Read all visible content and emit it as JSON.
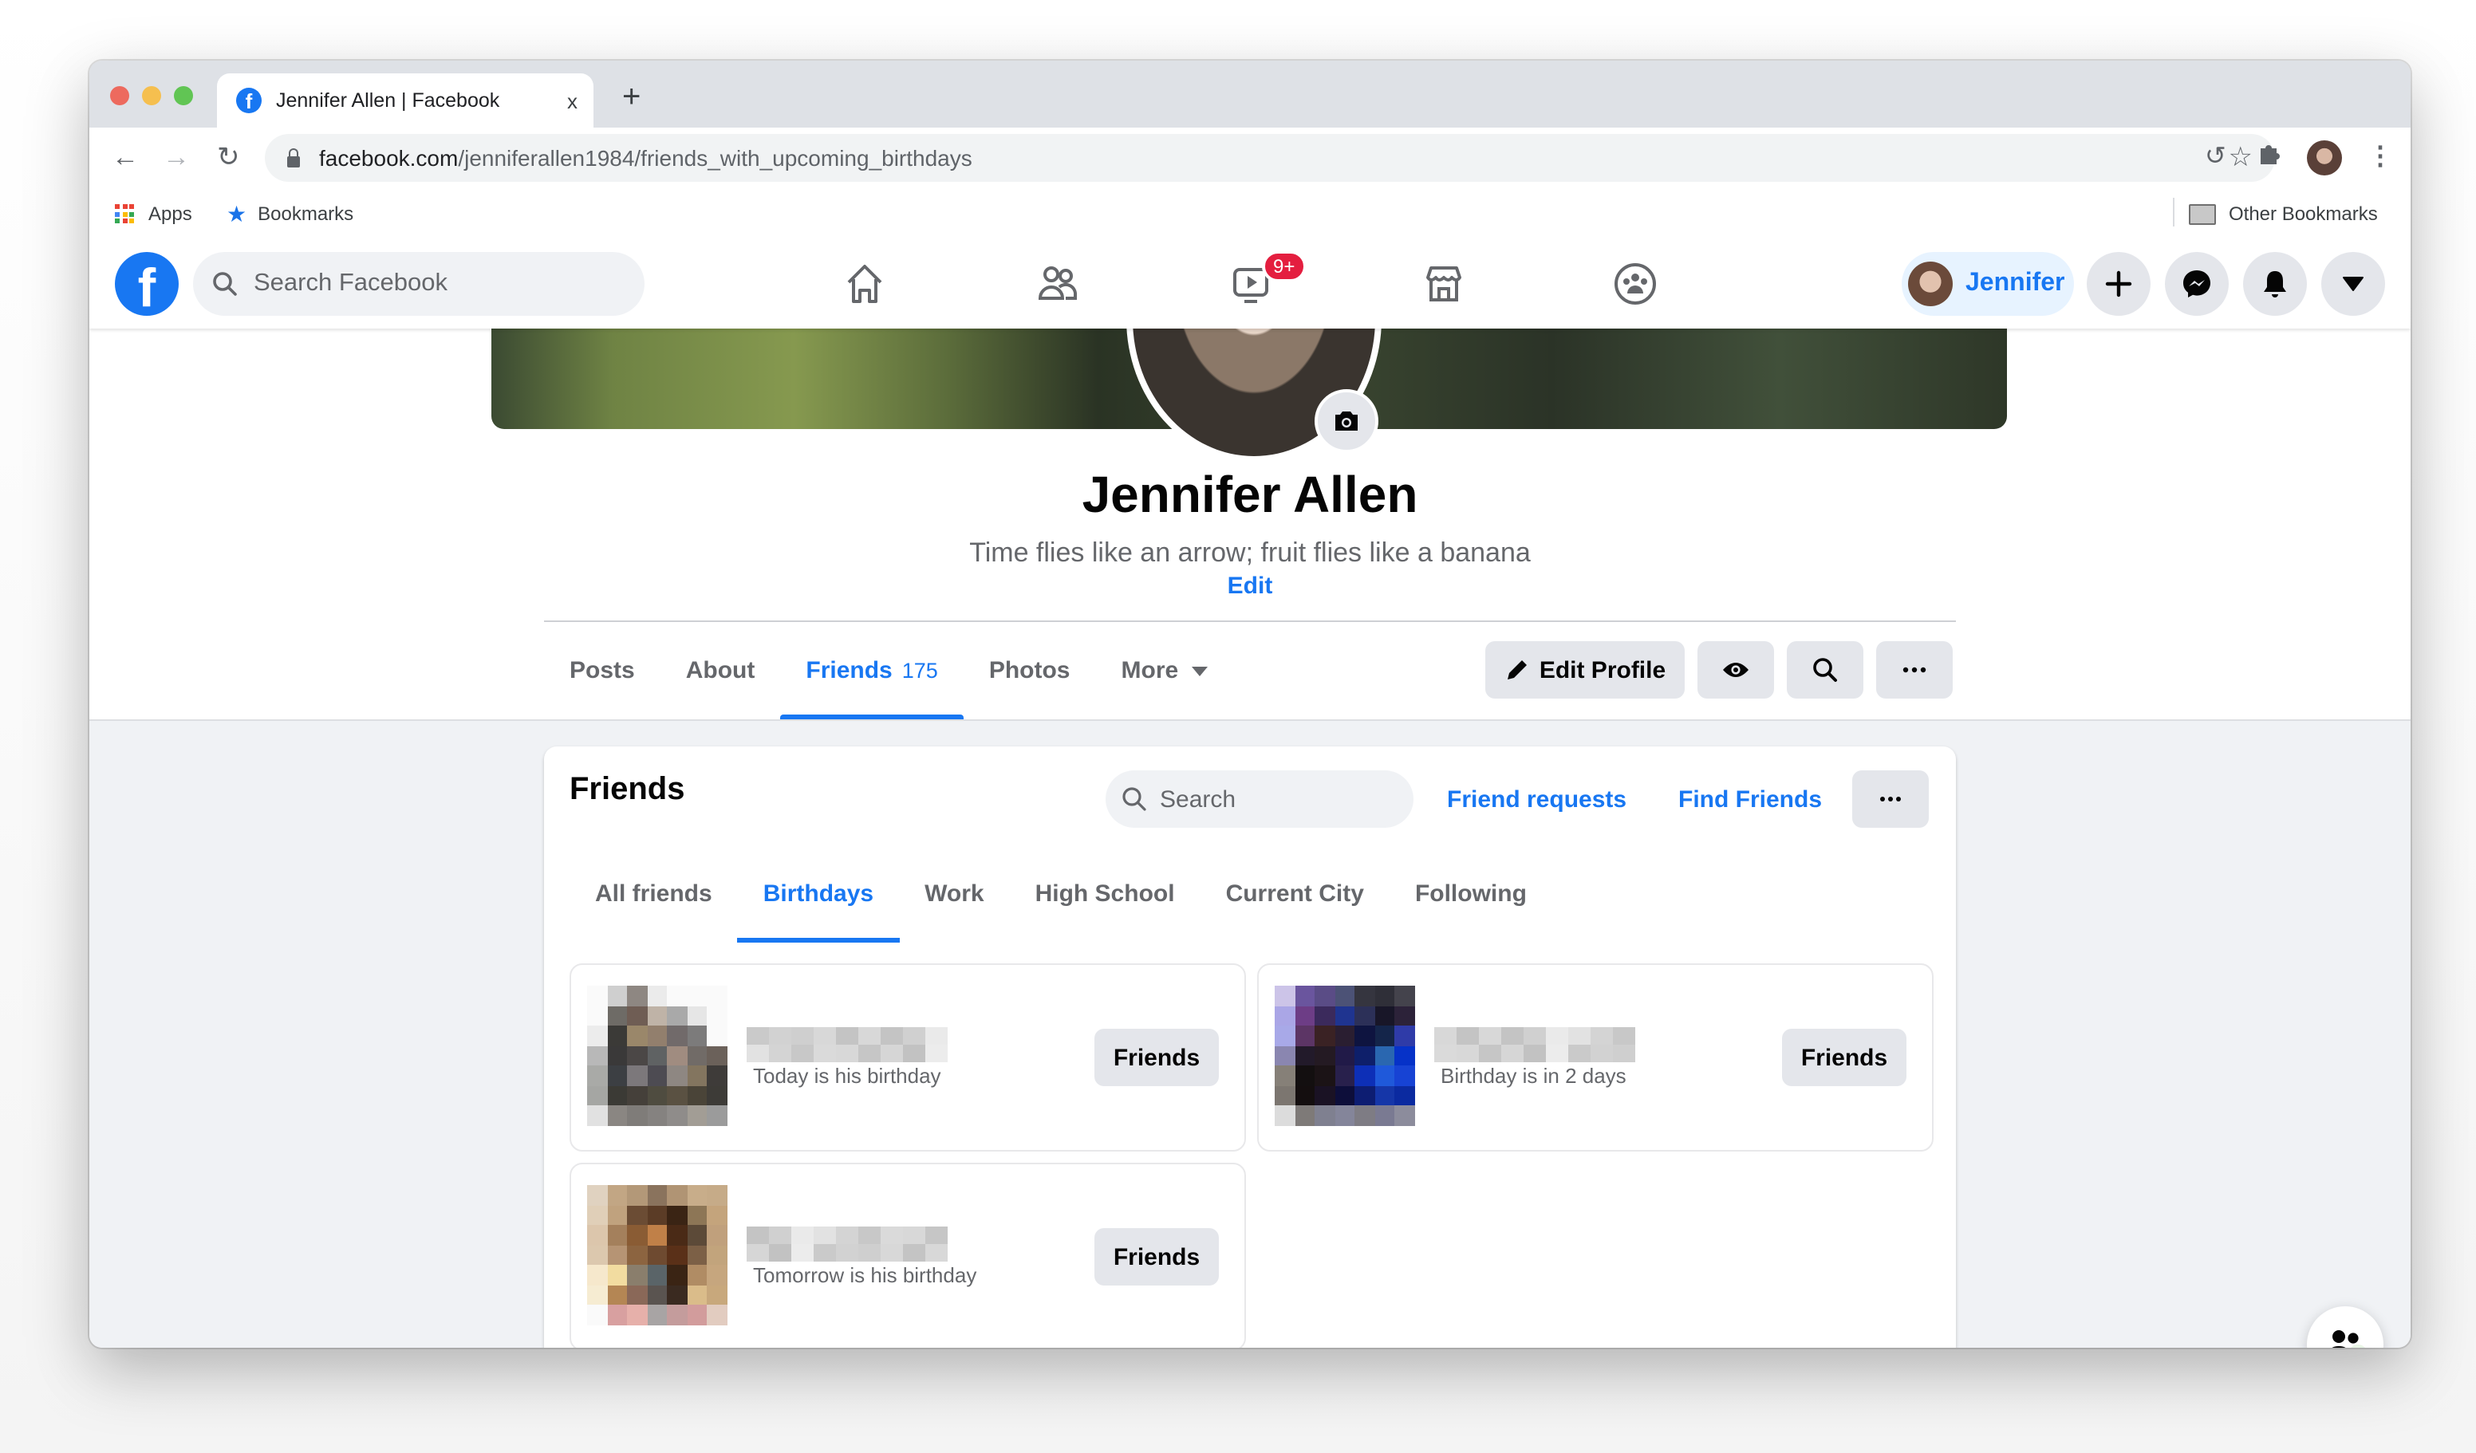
{
  "browser": {
    "tab_title": "Jennifer Allen | Facebook",
    "tab_close": "x",
    "new_tab": "+",
    "url_domain": "facebook.com",
    "url_path": "/jenniferallen1984/friends_with_upcoming_birthdays",
    "bookmarks": {
      "apps_label": "Apps",
      "bookmarks_label": "Bookmarks",
      "other_label": "Other Bookmarks"
    }
  },
  "fb_nav": {
    "search_placeholder": "Search Facebook",
    "watch_badge": "9+",
    "user_name": "Jennifer"
  },
  "profile": {
    "name": "Jennifer Allen",
    "bio": "Time flies like an arrow; fruit flies like a banana",
    "bio_edit": "Edit",
    "tabs": [
      {
        "label": "Posts"
      },
      {
        "label": "About"
      },
      {
        "label": "Friends",
        "count": "175",
        "active": true
      },
      {
        "label": "Photos"
      },
      {
        "label": "More"
      }
    ],
    "edit_profile_label": "Edit Profile"
  },
  "friends_card": {
    "title": "Friends",
    "search_placeholder": "Search",
    "friend_requests": "Friend requests",
    "find_friends": "Find Friends",
    "tabs": [
      {
        "label": "All friends"
      },
      {
        "label": "Birthdays",
        "active": true
      },
      {
        "label": "Work"
      },
      {
        "label": "High School"
      },
      {
        "label": "Current City"
      },
      {
        "label": "Following"
      }
    ],
    "items": [
      {
        "subtitle": "Today is his birthday",
        "button": "Friends"
      },
      {
        "subtitle": "Birthday is in 2 days",
        "button": "Friends"
      },
      {
        "subtitle": "Tomorrow is his birthday",
        "button": "Friends"
      }
    ]
  },
  "contacts_fab": {
    "online_count": "0"
  },
  "colors": {
    "brand_blue": "#1877f2",
    "badge_red": "#e41e3f",
    "button_gray": "#e4e6eb"
  }
}
